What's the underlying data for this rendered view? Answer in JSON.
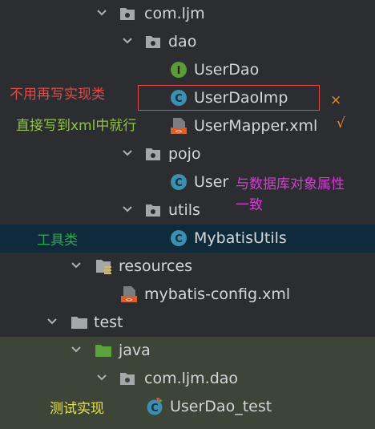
{
  "tree": {
    "package_root": "com.ljm",
    "dao_folder": "dao",
    "user_dao": "UserDao",
    "user_dao_imp": "UserDaoImp",
    "user_mapper": "UserMapper.xml",
    "pojo_folder": "pojo",
    "user_class": "User",
    "utils_folder": "utils",
    "mybatis_utils": "MybatisUtils",
    "resources_folder": "resources",
    "mybatis_config": "mybatis-config.xml",
    "test_folder": "test",
    "java_folder": "java",
    "test_package": "com.ljm.dao",
    "user_dao_test": "UserDao_test"
  },
  "annotations": {
    "no_impl": "不用再写实现类",
    "write_xml": "直接写到xml中就行",
    "cross": "×",
    "check": "√",
    "match_db_line1": "与数据库对象属性",
    "match_db_line2": "一致",
    "utils_note": "工具类",
    "test_note": "测试实现"
  },
  "icons": {
    "folder": "folder-icon",
    "interface": "interface-icon",
    "class": "class-icon",
    "xml": "xml-file-icon",
    "resources": "resources-folder-icon",
    "source_root": "test-source-root-icon",
    "test_class": "test-class-icon",
    "chevron": "chevron-down-icon"
  },
  "colors": {
    "background": "#2b2d30",
    "selected_row": "#0f2a3a",
    "test_row": "#3c4538",
    "text": "#d4d6d9",
    "red_note": "#e34a4a",
    "green_note": "#8ec63f",
    "orange_mark": "#f08a2c",
    "magenta_note": "#d63cd6",
    "yellow_note": "#e6e24a",
    "teal_note": "#2fa84f"
  }
}
